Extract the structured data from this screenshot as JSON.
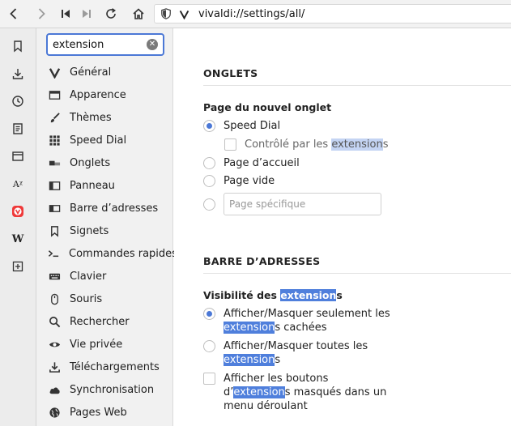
{
  "toolbar": {
    "buttons": [
      "back-icon",
      "forward-icon",
      "rewind-icon",
      "fast-forward-icon",
      "reload-icon",
      "home-icon"
    ],
    "address": "vivaldi://settings/all/"
  },
  "panels": [
    "bookmarks-icon",
    "downloads-icon",
    "history-icon",
    "notes-icon",
    "window-icon",
    "translate-icon",
    "vivaldi-icon",
    "wikipedia-icon",
    "add-panel-icon"
  ],
  "panel_labels": {
    "translate": "Aᵡ",
    "wikipedia": "W"
  },
  "search": {
    "value": "extension",
    "clear": "✕"
  },
  "nav": {
    "items": [
      {
        "label": "Général",
        "icon": "vivaldi-v-icon"
      },
      {
        "label": "Apparence",
        "icon": "folder-icon"
      },
      {
        "label": "Thèmes",
        "icon": "brush-icon"
      },
      {
        "label": "Speed Dial",
        "icon": "grid-icon"
      },
      {
        "label": "Onglets",
        "icon": "tabs-icon"
      },
      {
        "label": "Panneau",
        "icon": "panel-icon"
      },
      {
        "label": "Barre d’adresses",
        "icon": "address-bar-icon"
      },
      {
        "label": "Signets",
        "icon": "bookmark-icon"
      },
      {
        "label": "Commandes rapides",
        "icon": "quick-commands-icon"
      },
      {
        "label": "Clavier",
        "icon": "keyboard-icon"
      },
      {
        "label": "Souris",
        "icon": "mouse-icon"
      },
      {
        "label": "Rechercher",
        "icon": "search-icon"
      },
      {
        "label": "Vie privée",
        "icon": "eye-icon"
      },
      {
        "label": "Téléchargements",
        "icon": "download-icon"
      },
      {
        "label": "Synchronisation",
        "icon": "cloud-icon"
      },
      {
        "label": "Pages Web",
        "icon": "globe-icon"
      }
    ]
  },
  "tabs_section": {
    "title": "ONGLETS",
    "new_tab_page": {
      "title": "Page du nouvel onglet",
      "speed_dial": "Speed Dial",
      "controlled_pre": "Contrôlé par les ",
      "controlled_hl": "extension",
      "controlled_post": "s",
      "homepage": "Page d’accueil",
      "blank": "Page vide",
      "specific_placeholder": "Page spécifique"
    }
  },
  "address_section": {
    "title": "BARRE D’ADRESSES",
    "visibility": {
      "title_pre": "Visibilité des ",
      "title_hl": "extension",
      "title_post": "s",
      "opt1_line1": "Afficher/Masquer seulement les",
      "opt1_hl": "extension",
      "opt1_post": "s cachées",
      "opt2_line1": "Afficher/Masquer toutes les",
      "opt2_hl": "extension",
      "opt2_post": "s",
      "opt3_line1": "Afficher les boutons",
      "opt3_pre": "d’",
      "opt3_hl": "extension",
      "opt3_post": "s masqués dans un",
      "opt3_line3": "menu déroulant"
    }
  },
  "colors": {
    "accent": "#4b78d6",
    "highlight": "#4f7fdc",
    "vivaldi_red": "#ef3939"
  }
}
